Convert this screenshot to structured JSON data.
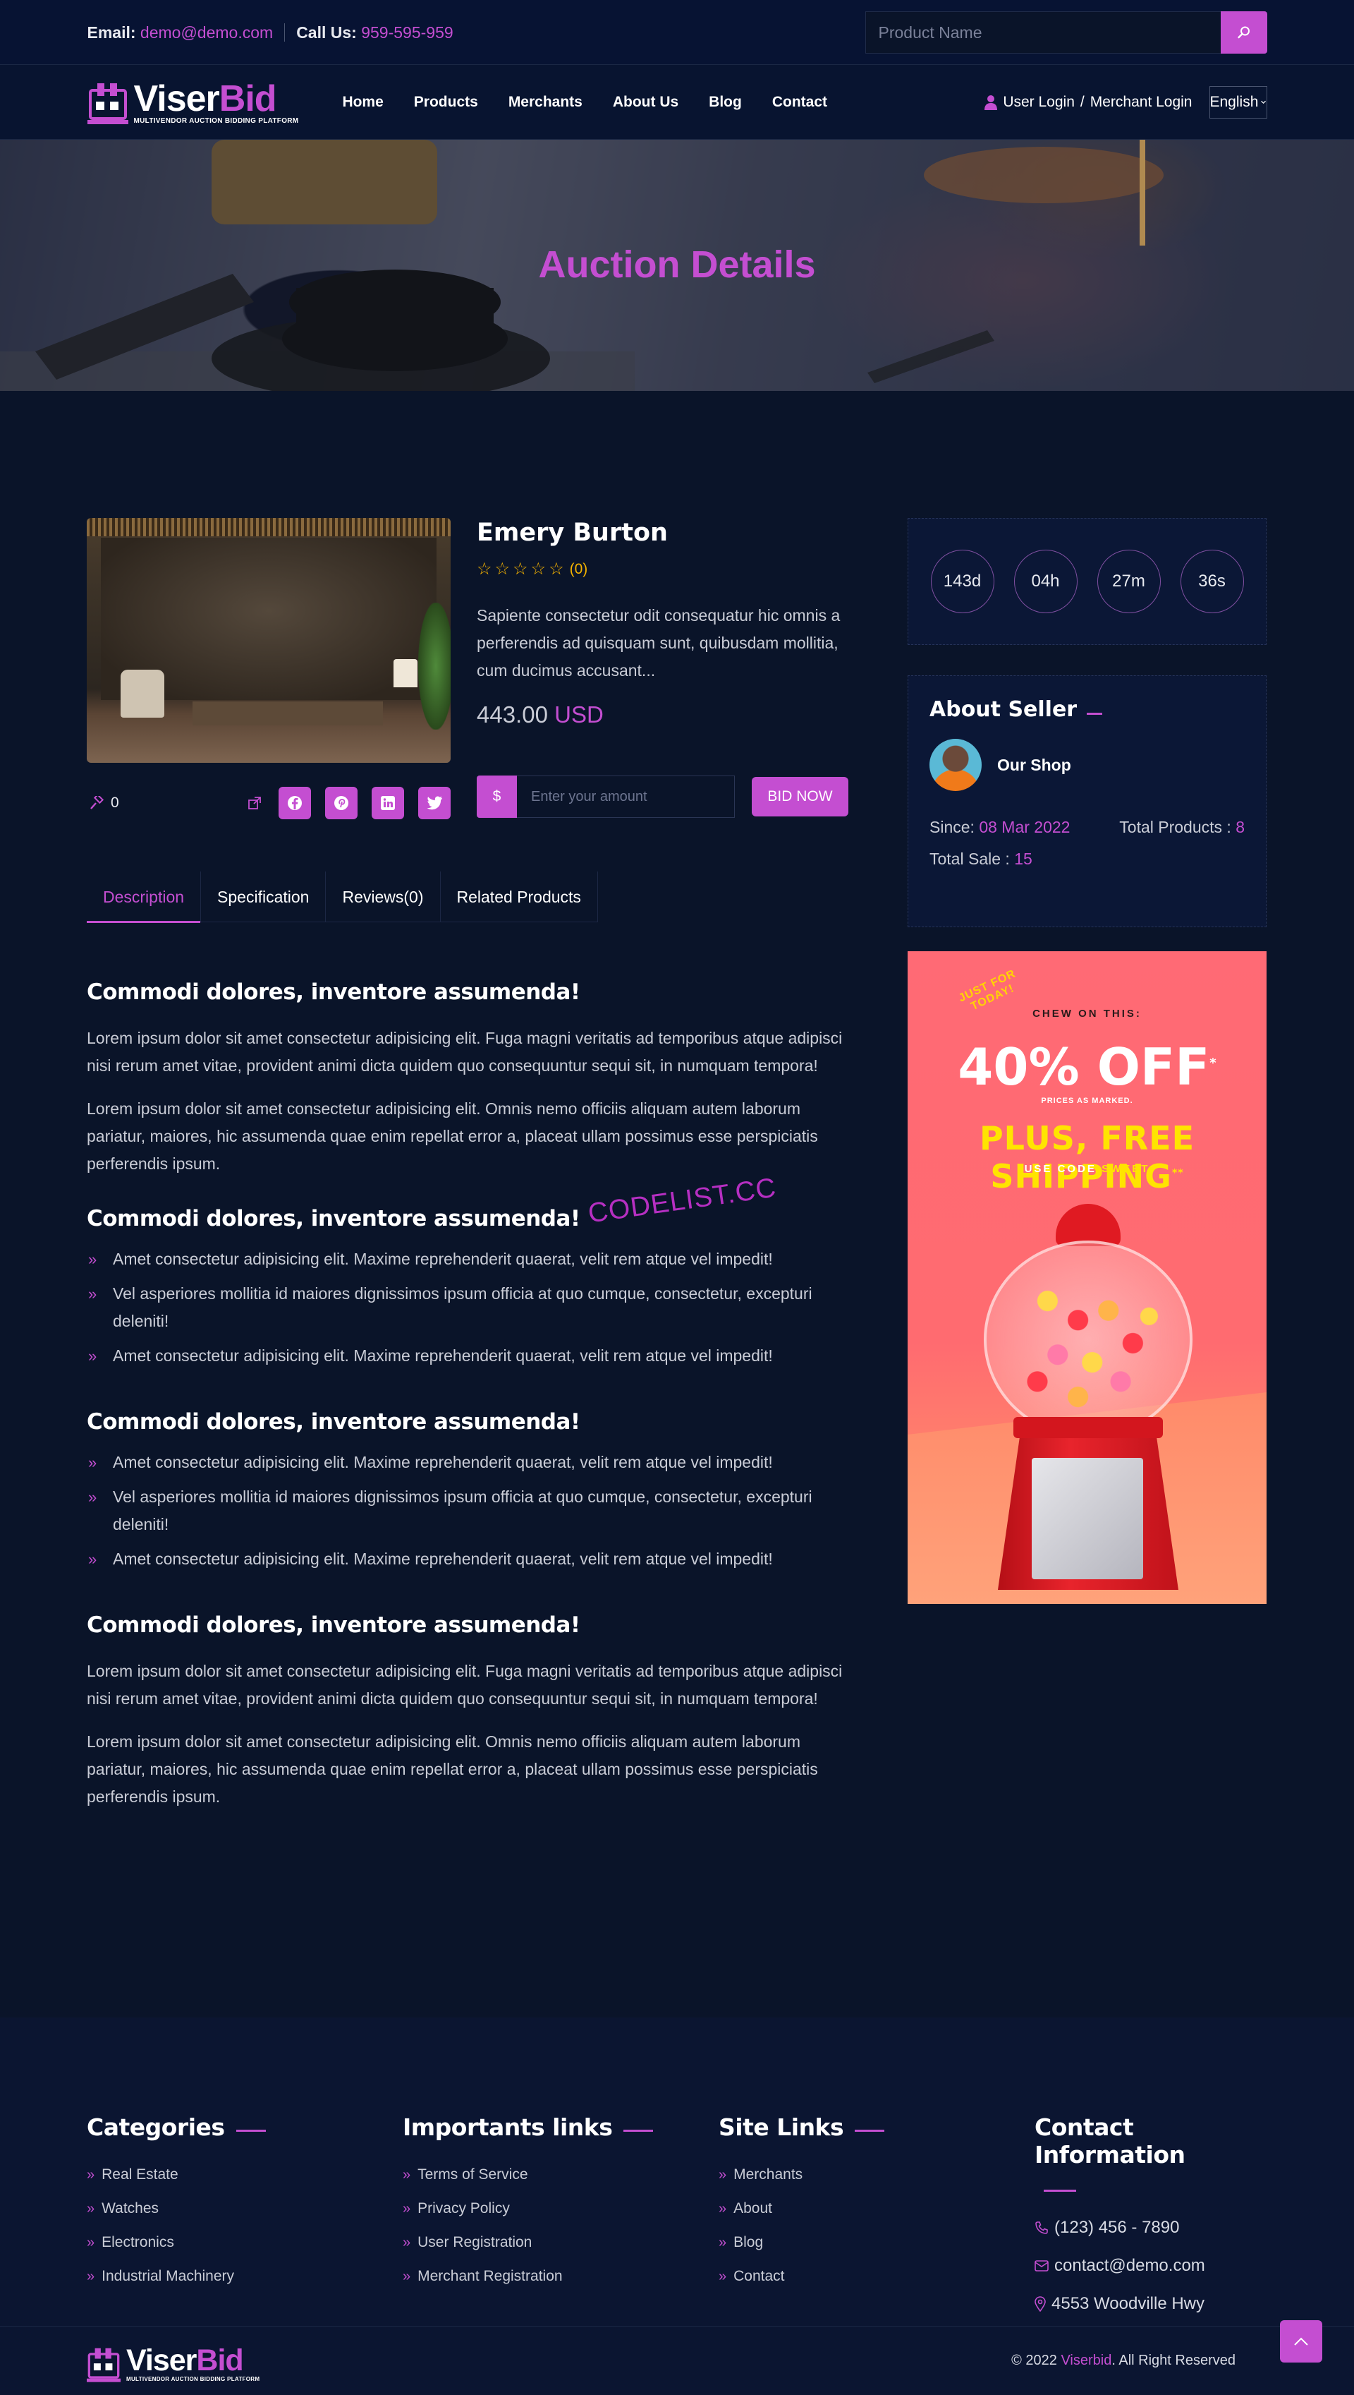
{
  "topbar": {
    "email_label": "Email:",
    "email": "demo@demo.com",
    "phone_label": "Call Us:",
    "phone": "959-595-959",
    "search_placeholder": "Product Name"
  },
  "header": {
    "logo_main": "Viser",
    "logo_accent": "Bid",
    "logo_tagline": "MULTIVENDOR AUCTION BIDDING PLATFORM",
    "nav": [
      "Home",
      "Products",
      "Merchants",
      "About Us",
      "Blog",
      "Contact"
    ],
    "user_login": "User Login",
    "separator": "/",
    "merchant_login": "Merchant Login",
    "language": "English"
  },
  "banner": {
    "title": "Auction Details"
  },
  "product": {
    "title": "Emery Burton",
    "rating_count": "(0)",
    "stars": 5,
    "rating": 0,
    "description": "Sapiente consectetur odit consequatur hic omnis a perferendis ad quisquam sunt, quibusdam mollitia, cum ducimus accusant...",
    "price": "443.00",
    "currency": "USD",
    "bid_count": "0",
    "socials": [
      "facebook-icon",
      "pinterest-icon",
      "linkedin-icon",
      "twitter-icon"
    ],
    "bid_form": {
      "symbol": "$",
      "placeholder": "Enter your amount",
      "button": "BID NOW"
    }
  },
  "tabs": [
    "Description",
    "Specification",
    "Reviews(0)",
    "Related Products"
  ],
  "description": {
    "heading1": "Commodi dolores, inventore assumenda!",
    "para1": "Lorem ipsum dolor sit amet consectetur adipisicing elit. Fuga magni veritatis ad temporibus atque adipisci nisi rerum amet vitae, provident animi dicta quidem quo consequuntur sequi sit, in numquam tempora!",
    "para2": "Lorem ipsum dolor sit amet consectetur adipisicing elit. Omnis nemo officiis aliquam autem laborum pariatur, maiores, hic assumenda quae enim repellat error a, placeat ullam possimus esse perspiciatis perferendis ipsum.",
    "heading2": "Commodi dolores, inventore assumenda!",
    "list1": [
      "Amet consectetur adipisicing elit. Maxime reprehenderit quaerat, velit rem atque vel impedit!",
      "Vel asperiores mollitia id maiores dignissimos ipsum officia at quo cumque, consectetur, excepturi deleniti!",
      "Amet consectetur adipisicing elit. Maxime reprehenderit quaerat, velit rem atque vel impedit!"
    ],
    "heading3": "Commodi dolores, inventore assumenda!",
    "list2": [
      "Amet consectetur adipisicing elit. Maxime reprehenderit quaerat, velit rem atque vel impedit!",
      "Vel asperiores mollitia id maiores dignissimos ipsum officia at quo cumque, consectetur, excepturi deleniti!",
      "Amet consectetur adipisicing elit. Maxime reprehenderit quaerat, velit rem atque vel impedit!"
    ],
    "heading4": "Commodi dolores, inventore assumenda!",
    "para3": "Lorem ipsum dolor sit amet consectetur adipisicing elit. Fuga magni veritatis ad temporibus atque adipisci nisi rerum amet vitae, provident animi dicta quidem quo consequuntur sequi sit, in numquam tempora!",
    "para4": "Lorem ipsum dolor sit amet consectetur adipisicing elit. Omnis nemo officiis aliquam autem laborum pariatur, maiores, hic assumenda quae enim repellat error a, placeat ullam possimus esse perspiciatis perferendis ipsum."
  },
  "watermark": "CODELIST.CC",
  "countdown": {
    "days": "143d",
    "hours": "04h",
    "minutes": "27m",
    "seconds": "36s"
  },
  "seller": {
    "heading": "About Seller",
    "shop_name": "Our Shop",
    "since_label": "Since:",
    "since": "08 Mar 2022",
    "products_label": "Total Products :",
    "products": "8",
    "sale_label": "Total Sale :",
    "sale": "15"
  },
  "ad": {
    "just": "JUST FOR TODAY!",
    "chew": "CHEW ON THIS:",
    "off": "40% OFF",
    "asterisk": "*",
    "prices": "PRICES AS MARKED.",
    "shipping": "PLUS, FREE SHIPPING",
    "shipping_mark": "**",
    "code_prefix": "USE CODE",
    "code": "SWEET"
  },
  "footer": {
    "categories_title": "Categories",
    "categories": [
      "Real Estate",
      "Watches",
      "Electronics",
      "Industrial Machinery"
    ],
    "important_title": "Importants links",
    "important": [
      "Terms of Service",
      "Privacy Policy",
      "User Registration",
      "Merchant Registration"
    ],
    "site_title": "Site Links",
    "site": [
      "Merchants",
      "About",
      "Blog",
      "Contact"
    ],
    "contact_title": "Contact Information",
    "phone": "(123) 456 - 7890",
    "email": "contact@demo.com",
    "address": "4553 Woodville Hwy",
    "copyright_prefix": "© 2022",
    "copyright_brand": "Viserbid",
    "copyright_suffix": ". All Right Reserved"
  },
  "colors": {
    "accent": "#c44ed1",
    "background": "#0a1429",
    "star": "#f5b300"
  }
}
